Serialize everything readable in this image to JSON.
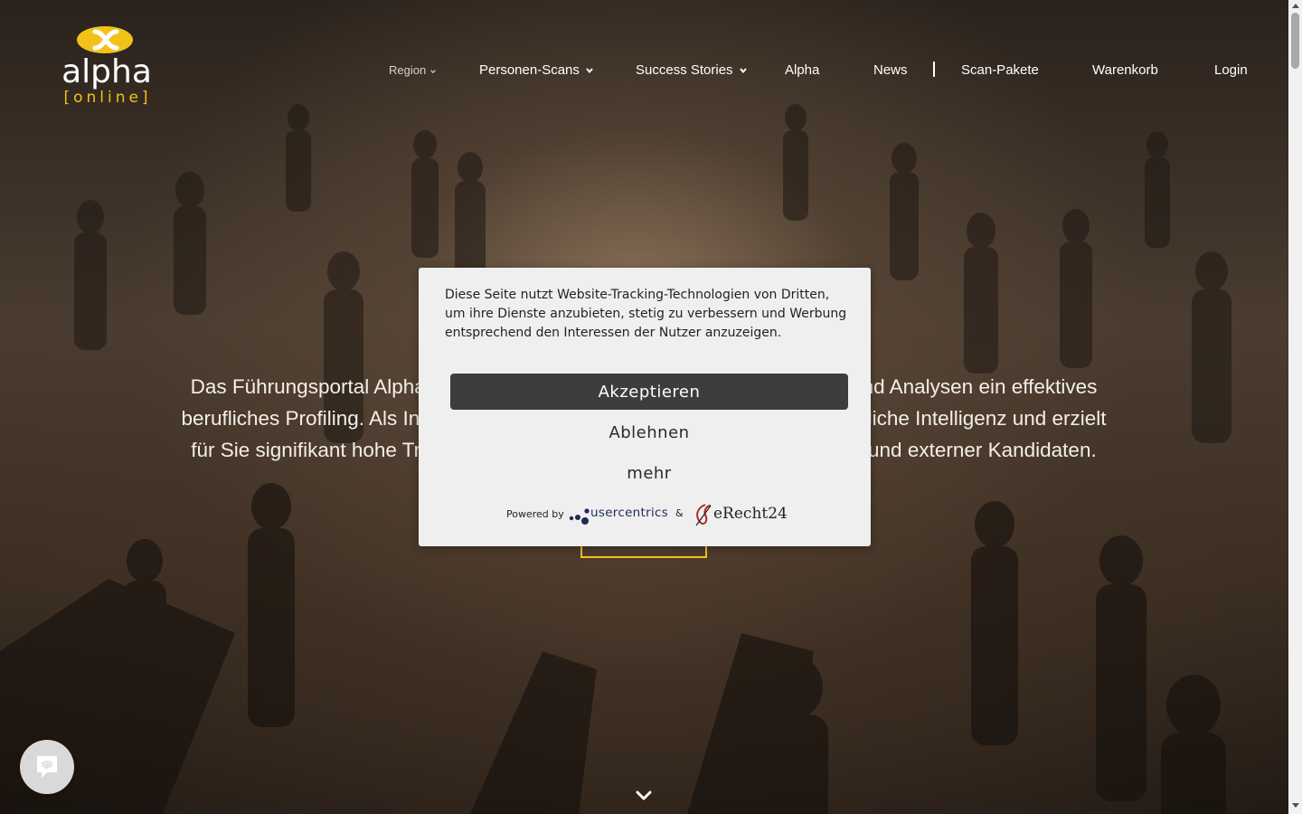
{
  "header": {
    "logo_word": "alpha",
    "logo_sub": "[online]",
    "nav": {
      "region": "Region",
      "personen_scans": "Personen-Scans",
      "success_stories": "Success Stories",
      "alpha": "Alpha",
      "news": "News",
      "scan_pakete": "Scan-Pakete",
      "warenkorb": "Warenkorb",
      "login": "Login"
    }
  },
  "hero": {
    "line1_left": "Das Führungsportal Alpha On",
    "line1_right": "ns und Analysen ein effektives",
    "line2_left": "berufliches Profiling. Als Innova",
    "line2_right": "ünstliche Intelligenz und erzielt",
    "line3_left": "für Sie signifikant hohe Treffer",
    "line3_right": "rner und externer Kandidaten."
  },
  "cookie": {
    "text": "Diese Seite nutzt Website-Tracking-Technologien von Dritten, um ihre Dienste anzubieten, stetig zu verbessern und Werbung entsprechend den Interessen der Nutzer anzuzeigen.",
    "accept": "Akzeptieren",
    "deny": "Ablehnen",
    "more": "mehr",
    "powered_by": "Powered by",
    "usercentrics": "usercentrics",
    "amp": "&",
    "erecht": "eRecht24"
  },
  "colors": {
    "accent_yellow": "#f2c21b",
    "dialog_bg": "#efefef",
    "accept_bg": "#3d3d3d"
  },
  "icons": {
    "scroll_down": "chevron-down-icon",
    "privacy": "fingerprint-icon",
    "nav_chevron": "chevron-down-icon"
  }
}
